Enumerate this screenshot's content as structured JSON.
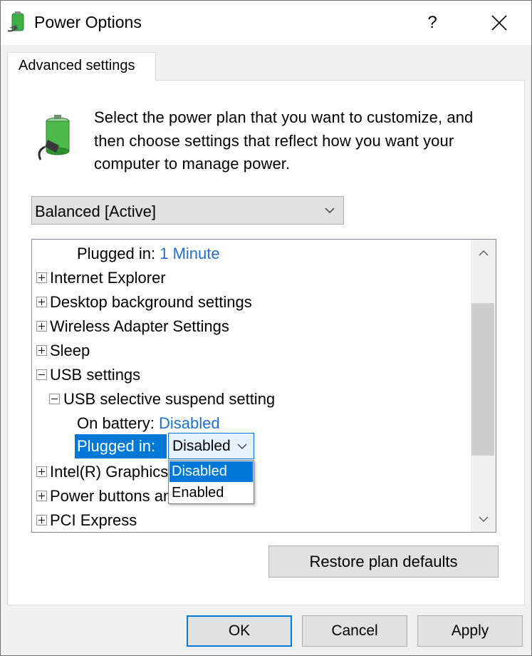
{
  "window": {
    "title": "Power Options",
    "help_label": "?"
  },
  "tabs": [
    {
      "label": "Advanced settings"
    }
  ],
  "description": "Select the power plan that you want to customize, and then choose settings that reflect how you want your computer to manage power.",
  "plan_select": {
    "value": "Balanced [Active]"
  },
  "tree": {
    "plugged_in_minute": {
      "label": "Plugged in:",
      "value": "1 Minute"
    },
    "items": [
      {
        "label": "Internet Explorer",
        "expander": "plus"
      },
      {
        "label": "Desktop background settings",
        "expander": "plus"
      },
      {
        "label": "Wireless Adapter Settings",
        "expander": "plus"
      },
      {
        "label": "Sleep",
        "expander": "plus"
      },
      {
        "label": "USB settings",
        "expander": "minus"
      },
      {
        "label": "USB selective suspend setting",
        "expander": "minus"
      },
      {
        "label": "On battery:",
        "value": "Disabled"
      },
      {
        "label": "Plugged in:",
        "value": "Disabled"
      },
      {
        "label": "Intel(R) Graphics Settings",
        "expander": "plus"
      },
      {
        "label": "Power buttons and lid",
        "expander": "plus"
      },
      {
        "label": "PCI Express",
        "expander": "plus"
      }
    ]
  },
  "dropdown": {
    "options": [
      "Disabled",
      "Enabled"
    ],
    "selected": "Disabled"
  },
  "buttons": {
    "restore": "Restore plan defaults",
    "ok": "OK",
    "cancel": "Cancel",
    "apply": "Apply"
  },
  "icons": {
    "title": "power-options-icon",
    "battery": "battery-plug-icon"
  },
  "colors": {
    "accent": "#0078d7",
    "link": "#1e6fd0"
  }
}
